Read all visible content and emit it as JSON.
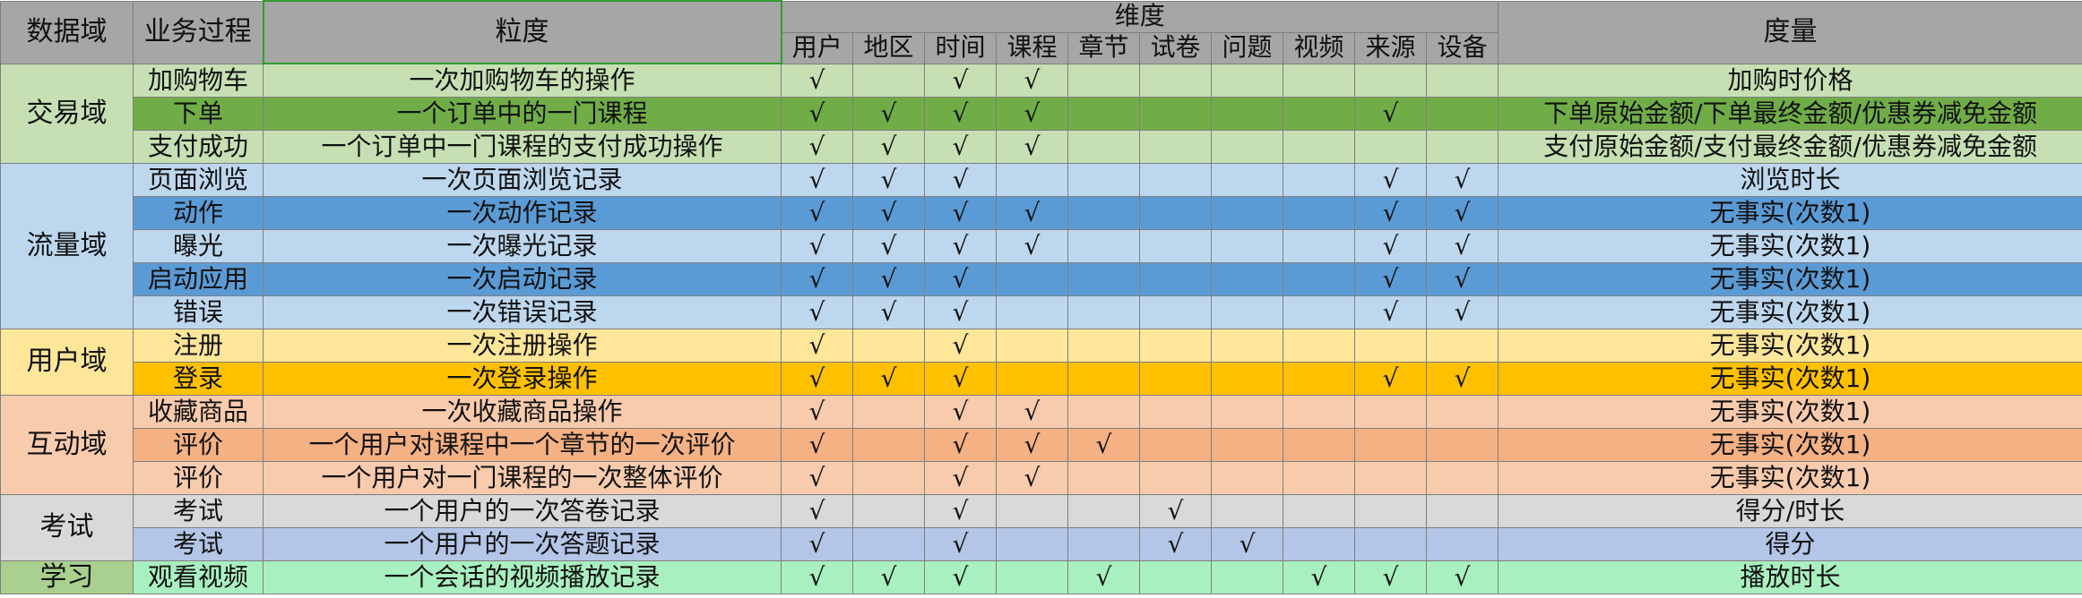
{
  "headers": {
    "domain": "数据域",
    "process": "业务过程",
    "granularity": "粒度",
    "dimensions_group": "维度",
    "measure": "度量",
    "dimensions": [
      "用户",
      "地区",
      "时间",
      "课程",
      "章节",
      "试卷",
      "问题",
      "视频",
      "来源",
      "设备"
    ]
  },
  "check_symbol": "√",
  "colors": {
    "header_bg": "#a6a6a6",
    "grid_border": "#7f7f7f",
    "granularity_header_border": "#2f9e2f"
  },
  "domains": [
    {
      "name": "交易域",
      "color": "#c6e0b4",
      "rows": 3
    },
    {
      "name": "流量域",
      "color": "#bdd7ee",
      "rows": 5
    },
    {
      "name": "用户域",
      "color": "#ffe699",
      "rows": 2
    },
    {
      "name": "互动域",
      "color": "#f8cbad",
      "rows": 3
    },
    {
      "name": "考试",
      "color": "#d9d9d9",
      "rows": 2
    },
    {
      "name": "学习",
      "color": "#a9d08e",
      "rows": 1
    }
  ],
  "rows": [
    {
      "process": "加购物车",
      "granularity": "一次加购物车的操作",
      "checks": [
        1,
        0,
        1,
        1,
        0,
        0,
        0,
        0,
        0,
        0
      ],
      "measure": "加购时价格",
      "color": "#c6e0b4"
    },
    {
      "process": "下单",
      "granularity": "一个订单中的一门课程",
      "checks": [
        1,
        1,
        1,
        1,
        0,
        0,
        0,
        0,
        1,
        0
      ],
      "measure": "下单原始金额/下单最终金额/优惠券减免金额",
      "color": "#70ad47"
    },
    {
      "process": "支付成功",
      "granularity": "一个订单中一门课程的支付成功操作",
      "checks": [
        1,
        1,
        1,
        1,
        0,
        0,
        0,
        0,
        0,
        0
      ],
      "measure": "支付原始金额/支付最终金额/优惠券减免金额",
      "color": "#c6e0b4"
    },
    {
      "process": "页面浏览",
      "granularity": "一次页面浏览记录",
      "checks": [
        1,
        1,
        1,
        0,
        0,
        0,
        0,
        0,
        1,
        1
      ],
      "measure": "浏览时长",
      "color": "#bdd7ee"
    },
    {
      "process": "动作",
      "granularity": "一次动作记录",
      "checks": [
        1,
        1,
        1,
        1,
        0,
        0,
        0,
        0,
        1,
        1
      ],
      "measure": "无事实(次数1)",
      "color": "#5b9bd5"
    },
    {
      "process": "曝光",
      "granularity": "一次曝光记录",
      "checks": [
        1,
        1,
        1,
        1,
        0,
        0,
        0,
        0,
        1,
        1
      ],
      "measure": "无事实(次数1)",
      "color": "#bdd7ee"
    },
    {
      "process": "启动应用",
      "granularity": "一次启动记录",
      "checks": [
        1,
        1,
        1,
        0,
        0,
        0,
        0,
        0,
        1,
        1
      ],
      "measure": "无事实(次数1)",
      "color": "#5b9bd5"
    },
    {
      "process": "错误",
      "granularity": "一次错误记录",
      "checks": [
        1,
        1,
        1,
        0,
        0,
        0,
        0,
        0,
        1,
        1
      ],
      "measure": "无事实(次数1)",
      "color": "#bdd7ee"
    },
    {
      "process": "注册",
      "granularity": "一次注册操作",
      "checks": [
        1,
        0,
        1,
        0,
        0,
        0,
        0,
        0,
        0,
        0
      ],
      "measure": "无事实(次数1)",
      "color": "#ffe699"
    },
    {
      "process": "登录",
      "granularity": "一次登录操作",
      "checks": [
        1,
        1,
        1,
        0,
        0,
        0,
        0,
        0,
        1,
        1
      ],
      "measure": "无事实(次数1)",
      "color": "#ffc000"
    },
    {
      "process": "收藏商品",
      "granularity": "一次收藏商品操作",
      "checks": [
        1,
        0,
        1,
        1,
        0,
        0,
        0,
        0,
        0,
        0
      ],
      "measure": "无事实(次数1)",
      "color": "#f8cbad"
    },
    {
      "process": "评价",
      "granularity": "一个用户对课程中一个章节的一次评价",
      "checks": [
        1,
        0,
        1,
        1,
        1,
        0,
        0,
        0,
        0,
        0
      ],
      "measure": "无事实(次数1)",
      "color": "#f4b183"
    },
    {
      "process": "评价",
      "granularity": "一个用户对一门课程的一次整体评价",
      "checks": [
        1,
        0,
        1,
        1,
        0,
        0,
        0,
        0,
        0,
        0
      ],
      "measure": "无事实(次数1)",
      "color": "#f8cbad"
    },
    {
      "process": "考试",
      "granularity": "一个用户的一次答卷记录",
      "checks": [
        1,
        0,
        1,
        0,
        0,
        1,
        0,
        0,
        0,
        0
      ],
      "measure": "得分/时长",
      "color": "#d9d9d9"
    },
    {
      "process": "考试",
      "granularity": "一个用户的一次答题记录",
      "checks": [
        1,
        0,
        1,
        0,
        0,
        1,
        1,
        0,
        0,
        0
      ],
      "measure": "得分",
      "color": "#b4c6e7"
    },
    {
      "process": "观看视频",
      "granularity": "一个会话的视频播放记录",
      "checks": [
        1,
        1,
        1,
        0,
        1,
        0,
        0,
        1,
        1,
        1
      ],
      "measure": "播放时长",
      "color": "#a9f0c0"
    }
  ]
}
